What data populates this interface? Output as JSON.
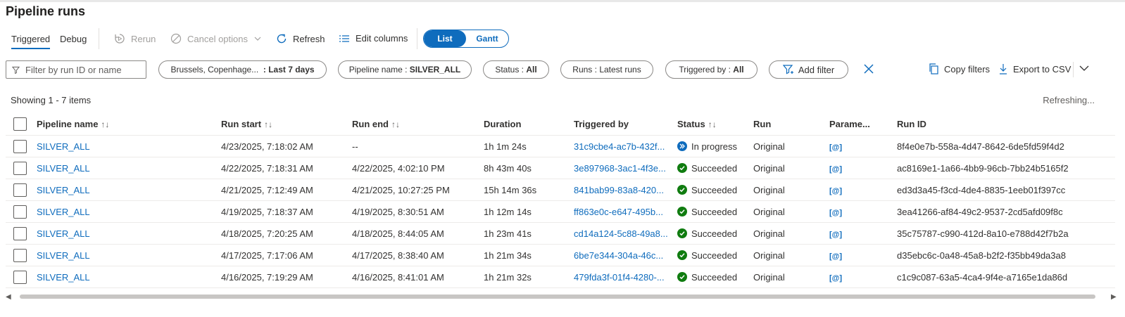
{
  "page": {
    "title": "Pipeline runs"
  },
  "tabs": [
    {
      "label": "Triggered",
      "active": true
    },
    {
      "label": "Debug",
      "active": false
    }
  ],
  "toolbar": {
    "rerun_label": "Rerun",
    "cancel_label": "Cancel options",
    "refresh_label": "Refresh",
    "edit_columns_label": "Edit columns",
    "view_list_label": "List",
    "view_gantt_label": "Gantt",
    "selected_view": "List"
  },
  "filters": {
    "search_placeholder": "Filter by run ID or name",
    "timezone_label": "Brussels, Copenhage...",
    "timezone_value": ": Last 7 days",
    "pipeline_label": "Pipeline name : ",
    "pipeline_value": "SILVER_ALL",
    "status_label": "Status : ",
    "status_value": "All",
    "runs_label": "Runs : ",
    "runs_value": "Latest runs",
    "triggered_label": "Triggered by : ",
    "triggered_value": "All",
    "add_filter_label": "Add filter",
    "copy_filters_label": "Copy filters",
    "export_label": "Export to CSV"
  },
  "summary": {
    "showing": "Showing 1 - 7 items",
    "refreshing": "Refreshing..."
  },
  "colors": {
    "accent": "#0f6cbd",
    "success": "#107c10"
  },
  "table": {
    "headers": {
      "pipeline_name": "Pipeline name",
      "run_start": "Run start",
      "run_end": "Run end",
      "duration": "Duration",
      "triggered_by": "Triggered by",
      "status": "Status",
      "run": "Run",
      "parameters": "Parame...",
      "run_id": "Run ID"
    },
    "rows": [
      {
        "pipeline": "SILVER_ALL",
        "start": "4/23/2025, 7:18:02 AM",
        "end": "--",
        "duration": "1h 1m 24s",
        "trigger": "31c9cbe4-ac7b-432f...",
        "status": "In progress",
        "status_icon": "in-progress-icon",
        "run": "Original",
        "params": "[@]",
        "run_id": "8f4e0e7b-558a-4d47-8642-6de5fd59f4d2"
      },
      {
        "pipeline": "SILVER_ALL",
        "start": "4/22/2025, 7:18:31 AM",
        "end": "4/22/2025, 4:02:10 PM",
        "duration": "8h 43m 40s",
        "trigger": "3e897968-3ac1-4f3e...",
        "status": "Succeeded",
        "status_icon": "check-circle-icon",
        "run": "Original",
        "params": "[@]",
        "run_id": "ac8169e1-1a66-4bb9-96cb-7bb24b5165f2"
      },
      {
        "pipeline": "SILVER_ALL",
        "start": "4/21/2025, 7:12:49 AM",
        "end": "4/21/2025, 10:27:25 PM",
        "duration": "15h 14m 36s",
        "trigger": "841bab99-83a8-420...",
        "status": "Succeeded",
        "status_icon": "check-circle-icon",
        "run": "Original",
        "params": "[@]",
        "run_id": "ed3d3a45-f3cd-4de4-8835-1eeb01f397cc"
      },
      {
        "pipeline": "SILVER_ALL",
        "start": "4/19/2025, 7:18:37 AM",
        "end": "4/19/2025, 8:30:51 AM",
        "duration": "1h 12m 14s",
        "trigger": "ff863e0c-e647-495b...",
        "status": "Succeeded",
        "status_icon": "check-circle-icon",
        "run": "Original",
        "params": "[@]",
        "run_id": "3ea41266-af84-49c2-9537-2cd5afd09f8c"
      },
      {
        "pipeline": "SILVER_ALL",
        "start": "4/18/2025, 7:20:25 AM",
        "end": "4/18/2025, 8:44:05 AM",
        "duration": "1h 23m 41s",
        "trigger": "cd14a124-5c88-49a8...",
        "status": "Succeeded",
        "status_icon": "check-circle-icon",
        "run": "Original",
        "params": "[@]",
        "run_id": "35c75787-c990-412d-8a10-e788d42f7b2a"
      },
      {
        "pipeline": "SILVER_ALL",
        "start": "4/17/2025, 7:17:06 AM",
        "end": "4/17/2025, 8:38:40 AM",
        "duration": "1h 21m 34s",
        "trigger": "6be7e344-304a-46c...",
        "status": "Succeeded",
        "status_icon": "check-circle-icon",
        "run": "Original",
        "params": "[@]",
        "run_id": "d35ebc6c-0a48-45a8-b2f2-f35bb49da3a8"
      },
      {
        "pipeline": "SILVER_ALL",
        "start": "4/16/2025, 7:19:29 AM",
        "end": "4/16/2025, 8:41:01 AM",
        "duration": "1h 21m 32s",
        "trigger": "479fda3f-01f4-4280-...",
        "status": "Succeeded",
        "status_icon": "check-circle-icon",
        "run": "Original",
        "params": "[@]",
        "run_id": "c1c9c087-63a5-4ca4-9f4e-a7165e1da86d"
      }
    ]
  }
}
